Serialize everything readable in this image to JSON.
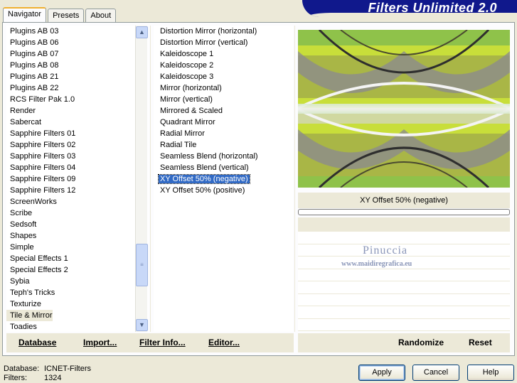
{
  "banner": {
    "title": "Filters Unlimited 2.0"
  },
  "tabs": [
    {
      "label": "Navigator",
      "active": true
    },
    {
      "label": "Presets"
    },
    {
      "label": "About"
    }
  ],
  "categories": [
    "Plugins AB 03",
    "Plugins AB 06",
    "Plugins AB 07",
    "Plugins AB 08",
    "Plugins AB 21",
    "Plugins AB 22",
    "RCS Filter Pak 1.0",
    "Render",
    "Sabercat",
    "Sapphire Filters 01",
    "Sapphire Filters 02",
    "Sapphire Filters 03",
    "Sapphire Filters 04",
    "Sapphire Filters 09",
    "Sapphire Filters 12",
    "ScreenWorks",
    "Scribe",
    "Sedsoft",
    "Shapes",
    "Simple",
    "Special Effects 1",
    "Special Effects 2",
    "Sybia",
    "Teph's Tricks",
    "Texturize",
    "Tile & Mirror",
    "Toadies"
  ],
  "selected_category": "Tile & Mirror",
  "filters": [
    "Distortion Mirror (horizontal)",
    "Distortion Mirror (vertical)",
    "Kaleidoscope 1",
    "Kaleidoscope 2",
    "Kaleidoscope 3",
    "Mirror (horizontal)",
    "Mirror (vertical)",
    "Mirrored & Scaled",
    "Quadrant Mirror",
    "Radial Mirror",
    "Radial Tile",
    "Seamless Blend (horizontal)",
    "Seamless Blend (vertical)",
    "XY Offset 50% (negative)",
    "XY Offset 50% (positive)"
  ],
  "selected_filter": "XY Offset 50% (negative)",
  "preview": {
    "filter_name": "XY Offset 50% (negative)"
  },
  "watermark": {
    "name": "Pinuccia",
    "url": "www.maidiregrafica.eu"
  },
  "left_buttons": {
    "database": "Database",
    "import": "Import...",
    "filter_info": "Filter Info...",
    "editor": "Editor..."
  },
  "right_buttons": {
    "randomize": "Randomize",
    "reset": "Reset"
  },
  "status": {
    "database_label": "Database:",
    "database_value": "ICNET-Filters",
    "filters_label": "Filters:",
    "filters_value": "1324"
  },
  "dialog_buttons": {
    "apply": "Apply",
    "cancel": "Cancel",
    "help": "Help"
  },
  "colors": {
    "banner": "#10188c",
    "selection": "#316ac5",
    "face": "#ece9d8"
  }
}
